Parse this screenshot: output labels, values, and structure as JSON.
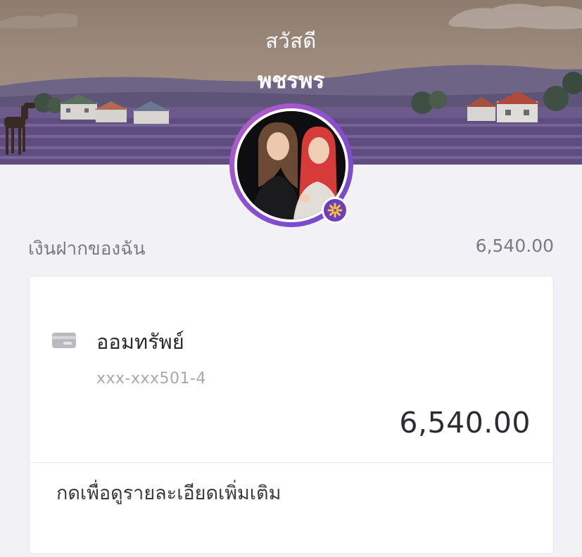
{
  "header": {
    "greeting": "สวัสดี",
    "user_name": "พชรพร"
  },
  "deposits": {
    "label": "เงินฝากของฉัน",
    "total": "6,540.00"
  },
  "account": {
    "icon": "card-icon",
    "name": "ออมทรัพย์",
    "number": "xxx-xxx501-4",
    "balance": "6,540.00",
    "details_link": "กดเพื่อดูรายละเอียดเพิ่มเติม"
  },
  "colors": {
    "accent": "#6d3fc0",
    "ring_start": "#c060c8",
    "ring_end": "#6e4ac8"
  }
}
